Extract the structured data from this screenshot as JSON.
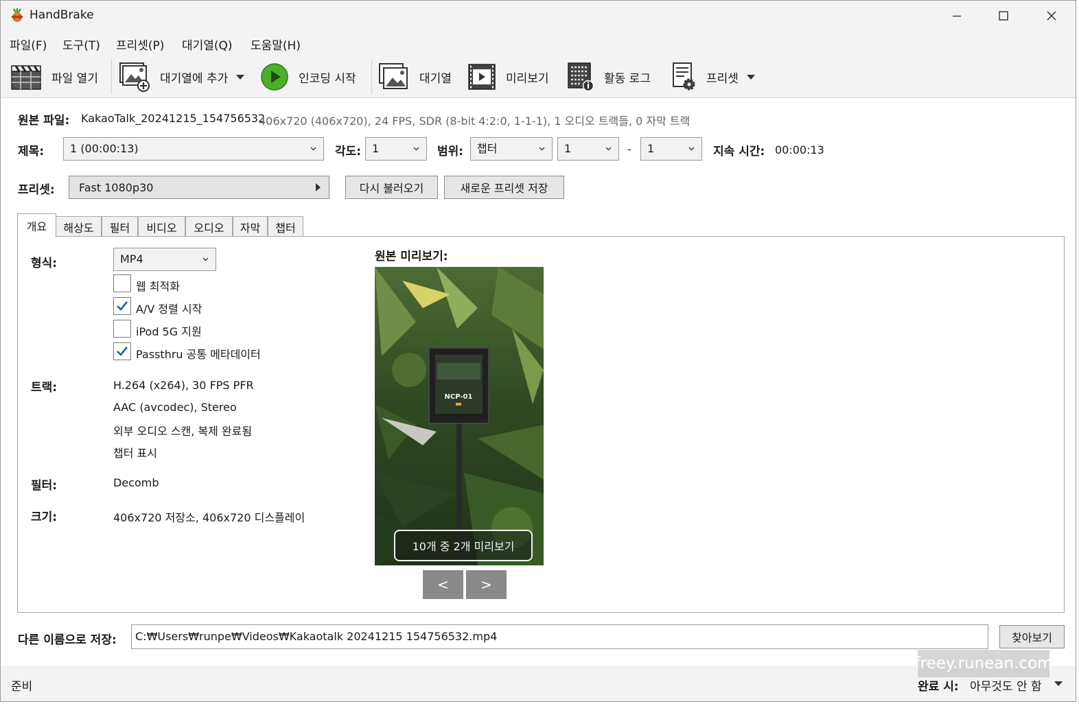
{
  "window": {
    "title": "HandBrake"
  },
  "menu": [
    "파일(F)",
    "도구(T)",
    "프리셋(P)",
    "대기열(Q)",
    "도움말(H)"
  ],
  "toolbar": {
    "open": "파일 열기",
    "add_queue": "대기열에 추가",
    "start": "인코딩 시작",
    "queue": "대기열",
    "preview": "미리보기",
    "activity": "활동 로그",
    "presets": "프리셋"
  },
  "source": {
    "label": "원본 파일:",
    "name": "KakaoTalk_20241215_154756532",
    "info": "406x720 (406x720), 24 FPS, SDR (8-bit 4:2:0, 1-1-1), 1 오디오 트랙들, 0 자막 트랙"
  },
  "title_row": {
    "title_label": "제목:",
    "title_value": "1  (00:00:13)",
    "angle_label": "각도:",
    "angle_value": "1",
    "range_label": "범위:",
    "range_type": "챕터",
    "range_start": "1",
    "range_sep": "-",
    "range_end": "1",
    "duration_label": "지속 시간:",
    "duration_value": "00:00:13"
  },
  "preset_row": {
    "label": "프리셋:",
    "value": "Fast 1080p30",
    "reload": "다시 불러오기",
    "save_new": "새로운 프리셋 저장"
  },
  "tabs": [
    "개요",
    "해상도",
    "필터",
    "비디오",
    "오디오",
    "자막",
    "챕터"
  ],
  "summary": {
    "format_label": "형식:",
    "format_value": "MP4",
    "checkboxes": [
      {
        "label": "웹 최적화",
        "checked": false
      },
      {
        "label": "A/V 정렬 시작",
        "checked": true
      },
      {
        "label": "iPod 5G 지원",
        "checked": false
      },
      {
        "label": "Passthru 공통 메타데이터",
        "checked": true
      }
    ],
    "tracks_label": "트랙:",
    "tracks": [
      "H.264 (x264), 30 FPS PFR",
      "AAC (avcodec), Stereo",
      "외부 오디오 스캔, 복제 완료됨",
      "챕터 표시"
    ],
    "filters_label": "필터:",
    "filters_value": "Decomb",
    "size_label": "크기:",
    "size_value": "406x720 저장소, 406x720 디스플레이",
    "preview_label": "원본 미리보기:",
    "preview_badge": "10개 중 2개 미리보기",
    "prev_btn": "<",
    "next_btn": ">",
    "sign_text": "NCP-01"
  },
  "save": {
    "label": "다른 이름으로 저장:",
    "path": "C:₩Users₩runpe₩Videos₩Kakaotalk 20241215 154756532.mp4",
    "browse": "찾아보기"
  },
  "status": {
    "text": "준비",
    "when_done_label": "완료 시:",
    "when_done_value": "아무것도 안 함"
  },
  "watermark": "freey.runean.com"
}
